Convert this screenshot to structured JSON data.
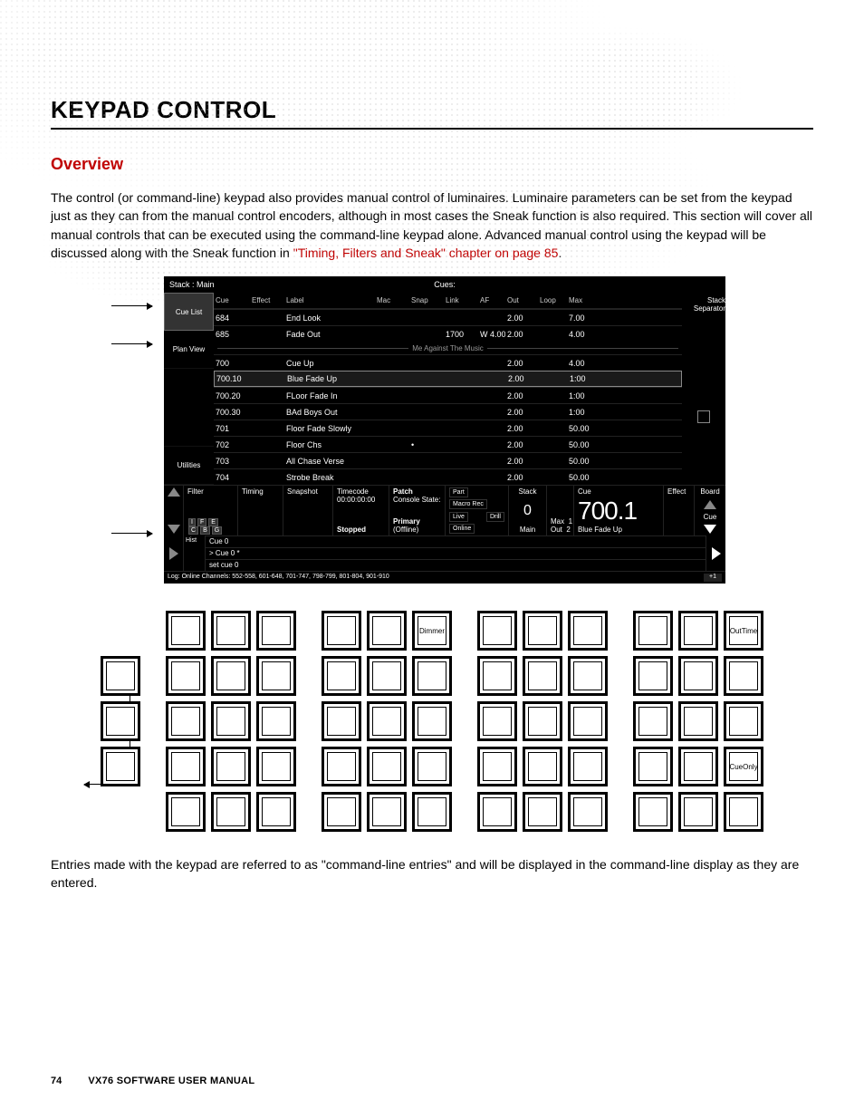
{
  "page": {
    "title": "KEYPAD CONTROL",
    "section": "Overview",
    "para1": "The control (or command-line) keypad also provides manual control of luminaires. Luminaire parameters can be set from the keypad just as they can from the manual control encoders, although in most cases the Sneak function is also required. This section will cover all manual controls that can be executed using the command-line keypad alone. Advanced manual control using the keypad will be discussed along with the Sneak function in ",
    "xref": "\"Timing, Filters and Sneak\" chapter on page 85",
    "para1_tail": ".",
    "para2": "Entries made with the keypad are referred to as \"command-line entries\" and will be displayed in the command-line display as they are entered.",
    "number": "74",
    "book": "VX76 SOFTWARE USER MANUAL"
  },
  "console": {
    "top": {
      "stack": "Stack : Main",
      "cues": "Cues:"
    },
    "tabs": {
      "cuelist": "Cue List",
      "planview": "Plan View",
      "utilities": "Utilities"
    },
    "stacksep": "Stack Separator",
    "filterrow": [
      "I",
      "F",
      "E",
      "C",
      "B",
      "G"
    ],
    "hdr": {
      "cue": "Cue",
      "effect": "Effect",
      "label": "Label",
      "mac": "Mac",
      "snap": "Snap",
      "link": "Link",
      "af": "AF",
      "out": "Out",
      "loop": "Loop",
      "max": "Max"
    },
    "divider": "Me Against The Music",
    "rows": [
      {
        "cue": "684",
        "label": "End Look",
        "out": "2.00",
        "max": "7.00"
      },
      {
        "cue": "685",
        "label": "Fade Out",
        "link": "1700",
        "af": "W 4.00",
        "out": "2.00",
        "max": "4.00"
      },
      {
        "cue": "700",
        "label": "Cue Up",
        "out": "2.00",
        "max": "4.00"
      },
      {
        "cue": "700.10",
        "label": "Blue Fade Up",
        "out": "2.00",
        "max": "1:00"
      },
      {
        "cue": "700.20",
        "label": "FLoor Fade In",
        "out": "2.00",
        "max": "1:00"
      },
      {
        "cue": "700.30",
        "label": "BAd Boys Out",
        "out": "2.00",
        "max": "1:00"
      },
      {
        "cue": "701",
        "label": "Floor Fade Slowly",
        "out": "2.00",
        "max": "50.00"
      },
      {
        "cue": "702",
        "label": "Floor Chs",
        "snap": "•",
        "out": "2.00",
        "max": "50.00"
      },
      {
        "cue": "703",
        "label": "All Chase Verse",
        "out": "2.00",
        "max": "50.00"
      },
      {
        "cue": "704",
        "label": "Strobe Break",
        "out": "2.00",
        "max": "50.00"
      }
    ],
    "status": {
      "filter": "Filter",
      "timing": "Timing",
      "snapshot": "Snapshot",
      "timecode_lbl": "Timecode",
      "timecode": "00:00:00:00",
      "stopped": "Stopped",
      "patch_lbl": "Patch",
      "cstate": "Console State:",
      "primary": "Primary",
      "offline": "(Offline)",
      "part": "Part",
      "macrorec": "Macro Rec",
      "live": "Live",
      "drill": "Drill",
      "online": "Online",
      "stack_lbl": "Stack",
      "stack_val": "0",
      "stack_main": "Main",
      "max": "Max",
      "out_lbl": "Out",
      "one": "1",
      "two": "2",
      "cue_lbl": "Cue",
      "cue_big": "700.1",
      "cue_sub": "Blue Fade Up",
      "effect": "Effect",
      "board": "Board",
      "cue_side": "Cue"
    },
    "cmd": {
      "cuezero": "Cue  0",
      "gt": "> Cue  0 *",
      "set": "set cue 0",
      "hist": "Hist"
    },
    "log": "Log: Online Channels: 552-558, 601-648, 701-747, 798-799, 801-804, 901-910",
    "plus": "+1"
  },
  "keys": {
    "dimmer": "Dimmer",
    "outtime": "OutTime",
    "cueonly": "CueOnly"
  }
}
